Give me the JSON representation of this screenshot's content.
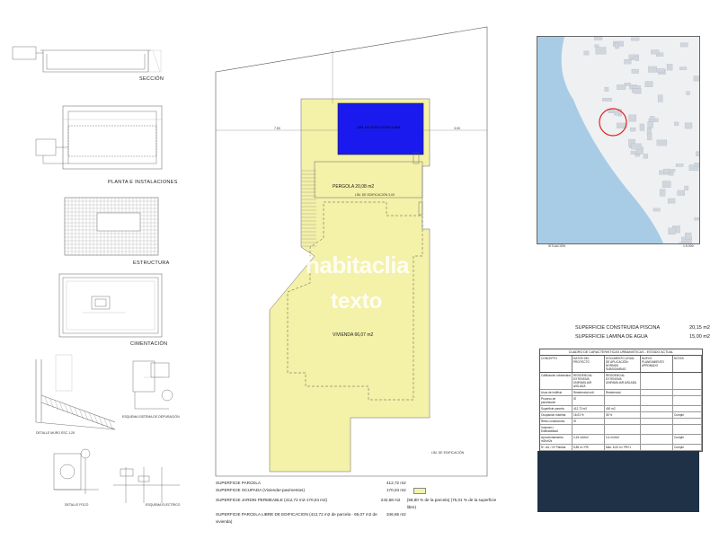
{
  "details": {
    "seccion": "SECCIÓN",
    "planta_instalaciones": "PLANTA E INSTALACIONES",
    "estructura": "ESTRUCTURA",
    "cimentacion": "CIMENTACIÓN",
    "detalle_muro": "DETALLE MURO ESC 1:25",
    "esquema_depuracion": "ESQUEMA SISTEMA DE DEPURACIÓN",
    "detalle_foco": "DETALLE FOCO",
    "esquema_electrico": "ESQUEMA ELECTRICO"
  },
  "plan": {
    "pergola_label": "PERGOLA 20,08 m2",
    "vivienda_label": "VIVIENDA 66,07 m2",
    "limite_edificacion": "LÍM. DE EDIFICACIÓN 3,00",
    "limite_edificacion_bottom": "LÍM. DE EDIFICACIÓN",
    "pool_label": "LÁM. DE EDIFICACIÓN 4,50M",
    "dim_left": "7.50",
    "dim_right": "3.00"
  },
  "watermark": {
    "brand": "habitaclia",
    "text": "texto"
  },
  "surfaces": [
    {
      "label": "SUPERFICIE PARCELA",
      "value": "412,72 m2",
      "note": ""
    },
    {
      "label": "SUPERFICIE OCUPADA (Vivienda+pavimentos)",
      "value": "170,04 m2",
      "note": ""
    },
    {
      "label": "SUPERFICIE JARDIN PERMEABLE (412,72 m2-170,04 m2)",
      "value": "242,68 m2",
      "note": "(58,80 % de la parcela) (75,01 % de la superficie libre)"
    },
    {
      "label": "SUPERFICIE PARCELA LIBRE DE EDIFICACION (412,72 m2 de parcela - 66,07 m2 de vivienda)",
      "value": "346,65 m2",
      "note": ""
    }
  ],
  "situacion": {
    "label": "SITUACIÓN",
    "scale": "1:5.000"
  },
  "pool_surfaces": [
    {
      "label": "SUPERFICIE CONSTRUIDA PISCINA",
      "value": "20,15 m2"
    },
    {
      "label": "SUPERFICIE LAMINA DE AGUA",
      "value": "15,00 m2"
    }
  ],
  "urban_table": {
    "title": "CUADRO DE CARACTERISTICAS URBANISTICAS - ESTADO ACTUAL",
    "headers": [
      "CONCEPTO",
      "DATOS DEL PROYECTO",
      "DOCUMENTO LEGAL DE APLICACIÓN: NORMAS SUBSIDIARIAS",
      "NUEVO PLANEAMIENTO APROBADO",
      "NOTAS"
    ],
    "rows": [
      [
        "Calificación urbanística",
        "RESIDENCIAL EXTENSIVA UNIFAMILIAR AISLADA",
        "RESIDENCIAL EXTENSIVA UNIFAMILIAR AISLADA",
        "",
        ""
      ],
      [
        "Usos del edificio",
        "Residencial unif.",
        "Residencial",
        "",
        ""
      ],
      [
        "Proceso de parcelación",
        "SÍ",
        "",
        "",
        ""
      ],
      [
        "Superficie parcela",
        "412,72 m2",
        "400 m2",
        "",
        ""
      ],
      [
        "Ocupación máxima",
        "16,03 %",
        "35 %",
        "",
        "Cumple"
      ],
      [
        "Retiro condiciones",
        "SÍ",
        "",
        "",
        ""
      ],
      [
        "Volumen / Edificabilidad",
        "",
        "",
        "",
        ""
      ],
      [
        "Aprovechamiento m2t/m2s",
        "0,15 m2/m2",
        "0,4 m2/m2",
        "",
        "Cumple"
      ],
      [
        "Nº. Alt. / Nº Plantas",
        "5,85 m / PB",
        "Máx. 8,00 m / PB+1",
        "",
        "Cumple"
      ]
    ]
  },
  "colors": {
    "plot_fill": "#f4f1a8",
    "pool_fill": "#1a1aee",
    "dark_panel": "#1f3146",
    "map_water": "#a8cce6",
    "map_land": "#eef0f2"
  }
}
